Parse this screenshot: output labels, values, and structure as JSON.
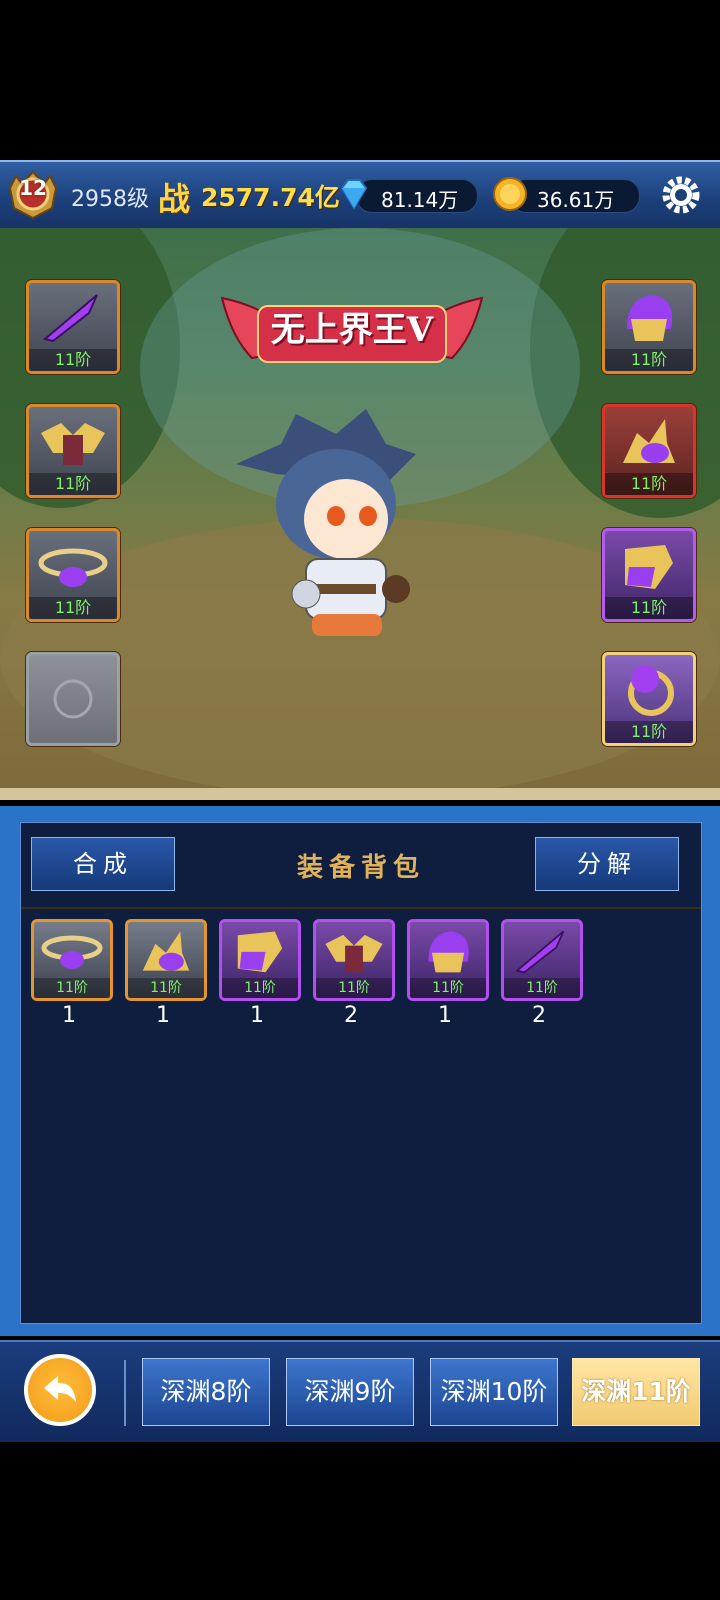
{
  "header": {
    "rank_badge": "12",
    "level": "2958级",
    "power_label": "战",
    "power_value": "2577.74亿",
    "diamonds": "81.14万",
    "gold": "36.61万",
    "icons": {
      "diamond": "diamond-icon",
      "coin": "gold-coin-icon",
      "settings": "gear-icon"
    }
  },
  "scene": {
    "title_badge": "无上界王V",
    "left_slots": [
      {
        "item": "purple-dagger",
        "tier": "11阶",
        "rarity": "orange"
      },
      {
        "item": "winged-armor",
        "tier": "11阶",
        "rarity": "orange"
      },
      {
        "item": "purple-belt",
        "tier": "11阶",
        "rarity": "orange"
      },
      {
        "item": "empty",
        "tier": "",
        "rarity": "empty"
      }
    ],
    "right_slots": [
      {
        "item": "purple-helmet",
        "tier": "11阶",
        "rarity": "orange"
      },
      {
        "item": "horned-gauntlet",
        "tier": "11阶",
        "rarity": "red"
      },
      {
        "item": "golden-boots",
        "tier": "11阶",
        "rarity": "purple"
      },
      {
        "item": "purple-gem-ring",
        "tier": "11阶",
        "rarity": "gold"
      }
    ]
  },
  "bag": {
    "title": "装备背包",
    "synthesize_label": "合成",
    "decompose_label": "分解",
    "items": [
      {
        "item": "purple-belt",
        "tier": "11阶",
        "count": "1",
        "rarity": "orange"
      },
      {
        "item": "horned-gauntlet",
        "tier": "11阶",
        "count": "1",
        "rarity": "orange"
      },
      {
        "item": "golden-boots",
        "tier": "11阶",
        "count": "1",
        "rarity": "purple"
      },
      {
        "item": "winged-armor",
        "tier": "11阶",
        "count": "2",
        "rarity": "purple"
      },
      {
        "item": "purple-helmet",
        "tier": "11阶",
        "count": "1",
        "rarity": "purple"
      },
      {
        "item": "purple-dagger",
        "tier": "11阶",
        "count": "2",
        "rarity": "purple"
      }
    ]
  },
  "nav": {
    "back_icon": "back-arrow-icon",
    "tabs": [
      "深渊8阶",
      "深渊9阶",
      "深渊10阶",
      "深渊11阶"
    ],
    "active_tab": "深渊11阶"
  }
}
